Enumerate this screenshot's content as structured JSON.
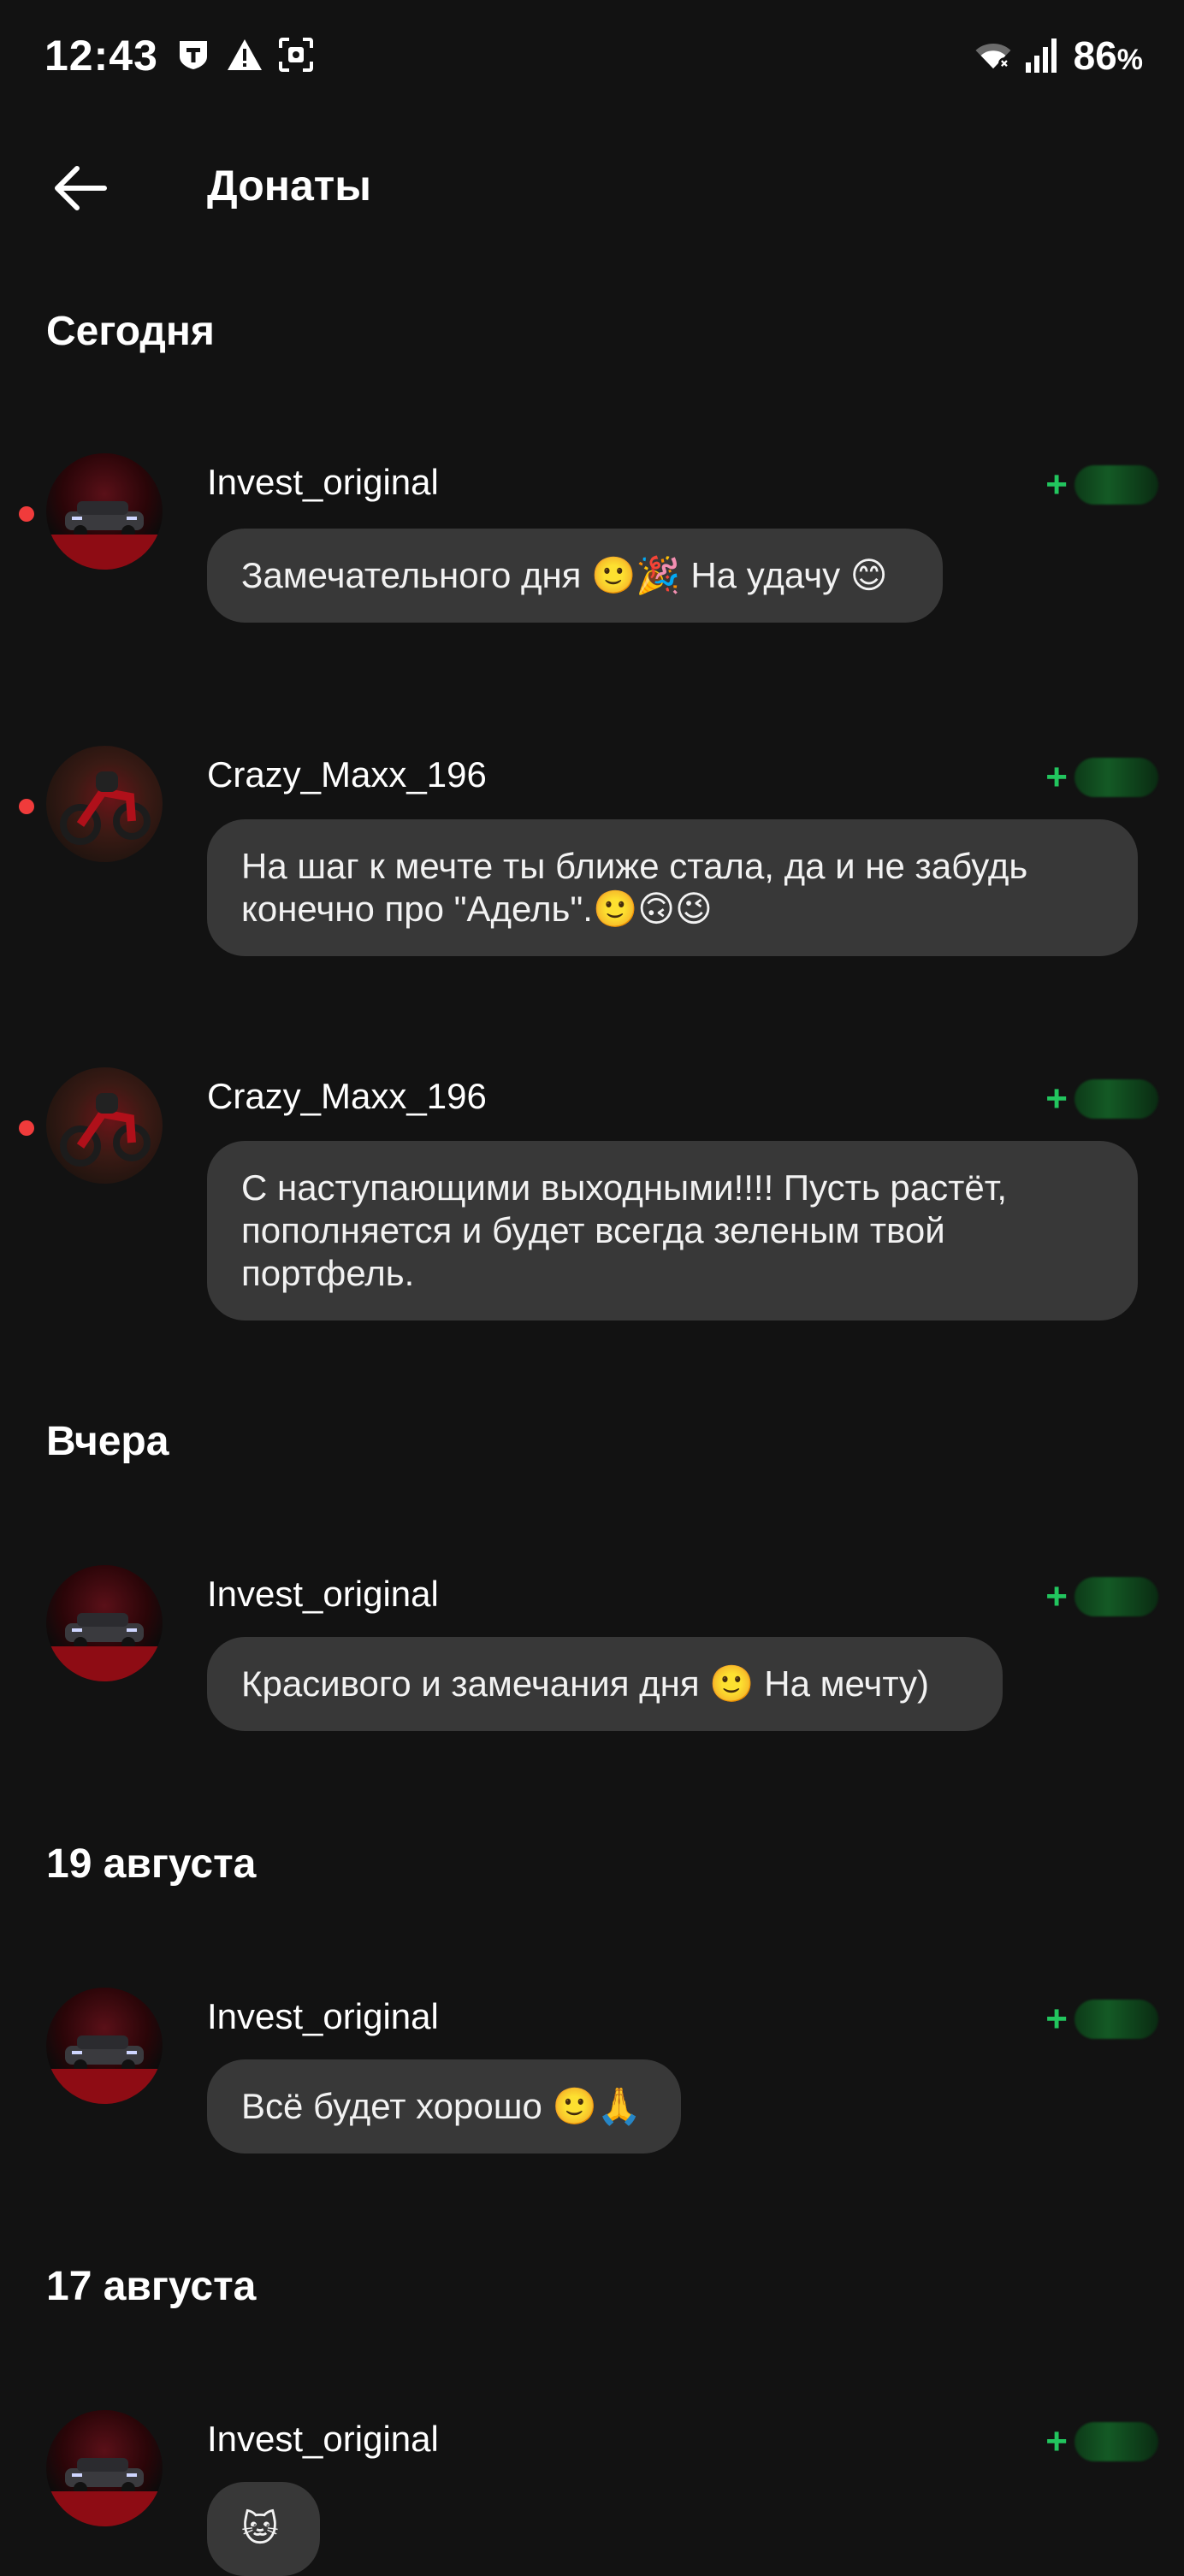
{
  "status_bar": {
    "time": "12:43",
    "battery": "86",
    "battery_unit": "%",
    "icons": [
      "tinkoff-icon",
      "warning-icon",
      "screenshot-icon",
      "wifi-icon",
      "signal-icon"
    ]
  },
  "header": {
    "title": "Донаты"
  },
  "sections": [
    {
      "heading": "Сегодня",
      "items": [
        {
          "name": "Invest_original",
          "message": "Замечательного дня 🙂🎉 На удачу 😊",
          "unread": true,
          "avatar": "car"
        },
        {
          "name": "Crazy_Maxx_196",
          "message": "На шаг к мечте ты ближе стала, да и не забудь конечно про \"Адель\".🙂🙃😉",
          "unread": true,
          "avatar": "moto"
        },
        {
          "name": "Crazy_Maxx_196",
          "message": "С наступающими выходными!!!! Пусть растёт, пополняется и будет всегда зеленым твой портфель.",
          "unread": true,
          "avatar": "moto"
        }
      ]
    },
    {
      "heading": "Вчера",
      "items": [
        {
          "name": "Invest_original",
          "message": "Красивого и замечания дня 🙂  На мечту)",
          "unread": false,
          "avatar": "car"
        }
      ]
    },
    {
      "heading": "19 августа",
      "items": [
        {
          "name": "Invest_original",
          "message": "Всё будет хорошо 🙂🙏",
          "unread": false,
          "avatar": "car"
        }
      ]
    },
    {
      "heading": "17 августа",
      "items": [
        {
          "name": "Invest_original",
          "message": "🐱",
          "unread": false,
          "avatar": "car"
        }
      ]
    }
  ],
  "amount_prefix": "+",
  "colors": {
    "background": "#121212",
    "bubble": "#383838",
    "accent_green": "#22c55e",
    "unread_dot": "#f03b3b"
  }
}
